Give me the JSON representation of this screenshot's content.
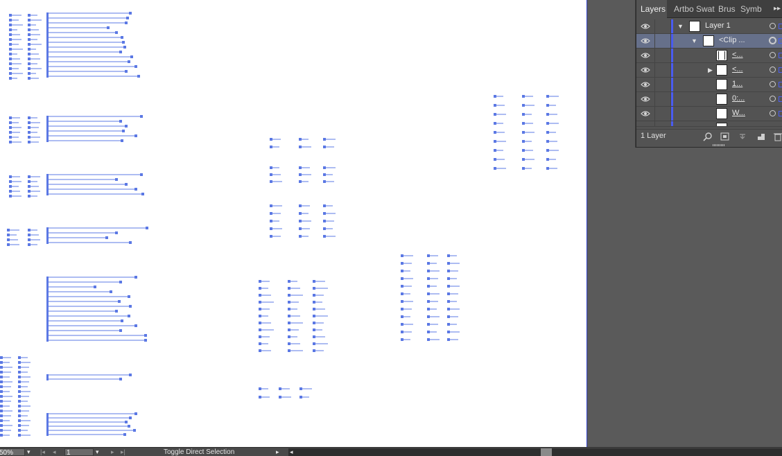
{
  "colors": {
    "accent": "#4a5cf0",
    "artwork_stroke": "#5b78e4",
    "canvas": "#ffffff",
    "pasteboard": "#5a5a5a",
    "panel": "#535353",
    "selected_row": "#66708a"
  },
  "layers_panel": {
    "tabs": [
      "Layers",
      "Artbo",
      "Swat",
      "Brus",
      "Symb"
    ],
    "menu_icon": "panel-menu-double-chevron-icon",
    "rows": [
      {
        "name": "Layer 1",
        "level": 0,
        "disclosure": "expanded",
        "underlined": false,
        "selected": false
      },
      {
        "name": "<Clip ...",
        "level": 1,
        "disclosure": "expanded",
        "underlined": false,
        "selected": true
      },
      {
        "name": "<...",
        "level": 2,
        "disclosure": "none",
        "underlined": true,
        "selected": false
      },
      {
        "name": "<...",
        "level": 2,
        "disclosure": "collapsed",
        "underlined": true,
        "selected": false
      },
      {
        "name": "1...",
        "level": 2,
        "disclosure": "none",
        "underlined": true,
        "selected": false
      },
      {
        "name": "0:...",
        "level": 2,
        "disclosure": "none",
        "underlined": true,
        "selected": false
      },
      {
        "name": "W...",
        "level": 2,
        "disclosure": "none",
        "underlined": true,
        "selected": false
      }
    ],
    "footer": {
      "label": "1 Layer",
      "icons": [
        "locate-object-icon",
        "make-clipping-mask-icon",
        "create-sublayer-icon",
        "new-layer-icon",
        "delete-trash-icon"
      ]
    }
  },
  "status_bar": {
    "zoom": "50%",
    "artboard_number": "1",
    "status_text": "Toggle Direct Selection",
    "icons": [
      "first-artboard-icon",
      "previous-artboard-icon",
      "next-artboard-icon",
      "last-artboard-icon",
      "status-menu-arrow-icon",
      "scroll-left-icon"
    ]
  }
}
